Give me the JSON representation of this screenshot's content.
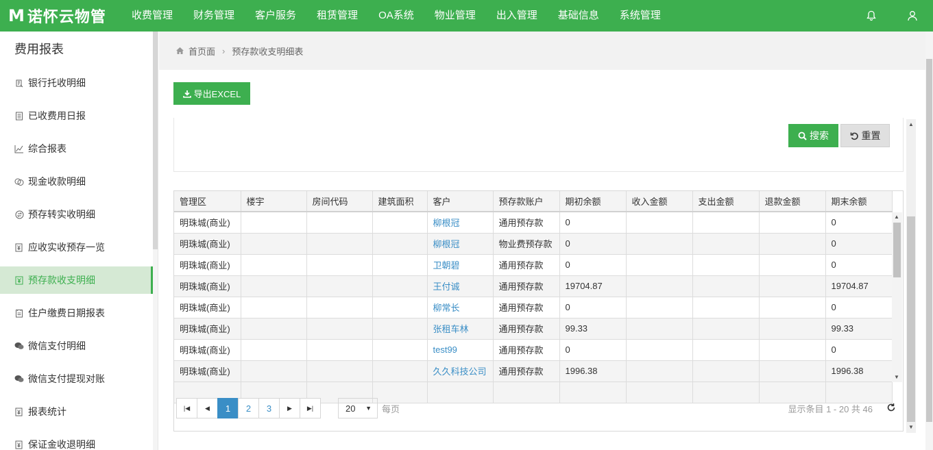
{
  "app": {
    "logo_mark": "M",
    "name": "诺怀云物管"
  },
  "nav": [
    {
      "label": "收费管理"
    },
    {
      "label": "财务管理"
    },
    {
      "label": "客户服务"
    },
    {
      "label": "租赁管理"
    },
    {
      "label": "OA系统"
    },
    {
      "label": "物业管理"
    },
    {
      "label": "出入管理"
    },
    {
      "label": "基础信息"
    },
    {
      "label": "系统管理"
    }
  ],
  "top_icons": [
    "bell-icon",
    "user-icon"
  ],
  "sidebar": {
    "title": "费用报表",
    "items": [
      {
        "label": "银行托收明细",
        "icon": "bank-icon"
      },
      {
        "label": "已收费用日报",
        "icon": "document-icon"
      },
      {
        "label": "综合报表",
        "icon": "line-chart-icon"
      },
      {
        "label": "现金收款明细",
        "icon": "cash-icon"
      },
      {
        "label": "预存转实收明细",
        "icon": "transfer-icon"
      },
      {
        "label": "应收实收预存一览",
        "icon": "yen-icon"
      },
      {
        "label": "预存款收支明细",
        "icon": "deposit-icon",
        "active": true
      },
      {
        "label": "住户缴费日期报表",
        "icon": "calendar-doc-icon"
      },
      {
        "label": "微信支付明细",
        "icon": "wechat-icon"
      },
      {
        "label": "微信支付提现对账",
        "icon": "wechat-icon"
      },
      {
        "label": "报表统计",
        "icon": "yen-icon"
      },
      {
        "label": "保证金收退明细",
        "icon": "yen-icon"
      }
    ]
  },
  "breadcrumb": {
    "home": "首页面",
    "current": "预存款收支明细表"
  },
  "toolbar": {
    "export_label": "导出EXCEL"
  },
  "search": {
    "search_label": "搜索",
    "reset_label": "重置"
  },
  "table": {
    "columns": [
      "管理区",
      "楼宇",
      "房间代码",
      "建筑面积",
      "客户",
      "预存款账户",
      "期初余额",
      "收入金额",
      "支出金额",
      "退款金额",
      "期末余额"
    ],
    "rows": [
      [
        "明珠城(商业)",
        "",
        "",
        "",
        "柳根冠",
        "通用预存款",
        "0",
        "",
        "",
        "",
        "0"
      ],
      [
        "明珠城(商业)",
        "",
        "",
        "",
        "柳根冠",
        "物业费预存款",
        "0",
        "",
        "",
        "",
        "0"
      ],
      [
        "明珠城(商业)",
        "",
        "",
        "",
        "卫朝碧",
        "通用预存款",
        "0",
        "",
        "",
        "",
        "0"
      ],
      [
        "明珠城(商业)",
        "",
        "",
        "",
        "王付诚",
        "通用预存款",
        "19704.87",
        "",
        "",
        "",
        "19704.87"
      ],
      [
        "明珠城(商业)",
        "",
        "",
        "",
        "柳常长",
        "通用预存款",
        "0",
        "",
        "",
        "",
        "0"
      ],
      [
        "明珠城(商业)",
        "",
        "",
        "",
        "张租车林",
        "通用预存款",
        "99.33",
        "",
        "",
        "",
        "99.33"
      ],
      [
        "明珠城(商业)",
        "",
        "",
        "",
        "test99",
        "通用预存款",
        "0",
        "",
        "",
        "",
        "0"
      ],
      [
        "明珠城(商业)",
        "",
        "",
        "",
        "久久科技公司",
        "通用预存款",
        "1996.38",
        "",
        "",
        "",
        "1996.38"
      ]
    ]
  },
  "pager": {
    "pages": [
      "1",
      "2",
      "3"
    ],
    "current": "1",
    "page_size": "20",
    "per_page_label": "每页",
    "info": "显示条目 1 - 20 共 46"
  },
  "colors": {
    "brand": "#3daf4f",
    "link": "#3a8ec6",
    "active_bg": "#d5e9d4"
  }
}
